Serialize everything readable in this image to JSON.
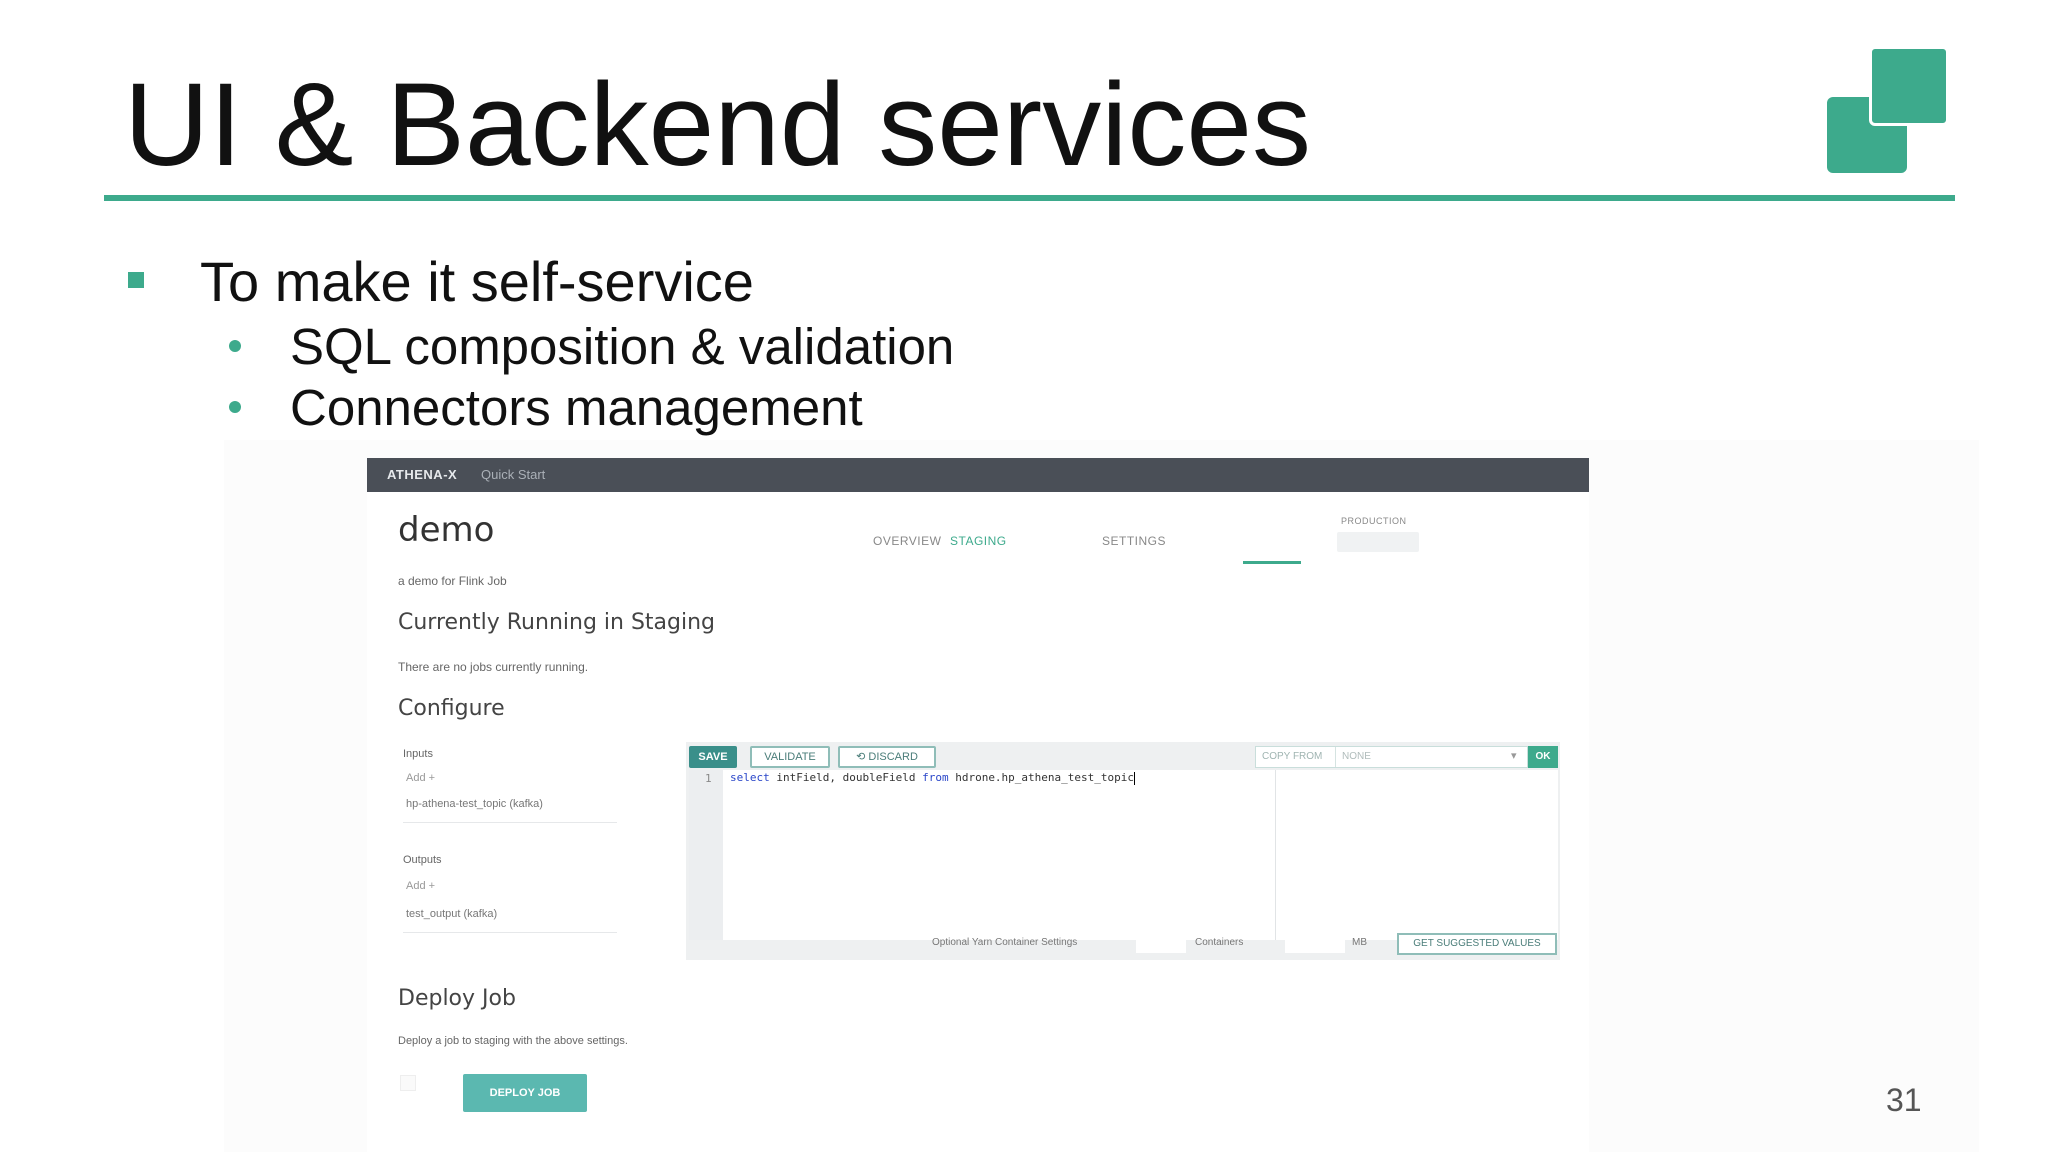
{
  "slide": {
    "title": "UI & Backend services",
    "page_number": "31",
    "bullets": {
      "level1": "To make it self-service",
      "level2": [
        "SQL composition & validation",
        "Connectors management"
      ]
    }
  },
  "app": {
    "brand": "ATHENA-X",
    "nav_link": "Quick Start",
    "job": {
      "title": "demo",
      "description": "a demo for Flink Job"
    },
    "tabs": {
      "overview": "OVERVIEW",
      "staging": "STAGING",
      "production_label": "PRODUCTION",
      "settings": "SETTINGS"
    },
    "running": {
      "heading": "Currently Running in Staging",
      "message": "There are no jobs currently running."
    },
    "configure": {
      "heading": "Configure",
      "inputs_label": "Inputs",
      "inputs_add": "Add +",
      "input_item": "hp-athena-test_topic (kafka)",
      "outputs_label": "Outputs",
      "outputs_add": "Add +",
      "output_item": "test_output (kafka)"
    },
    "editor": {
      "save": "SAVE",
      "validate": "VALIDATE",
      "discard": "⟲ DISCARD",
      "copy_from": "COPY FROM",
      "copy_value": "NONE",
      "ok": "OK",
      "line_number": "1",
      "code_keyword": "select",
      "code_fields": " intField, doubleField ",
      "code_from": "from",
      "code_table": " hdrone.hp_athena_test_topic",
      "yarn_settings": "Optional Yarn Container Settings",
      "containers": "Containers",
      "mb": "MB",
      "suggest": "GET SUGGESTED VALUES"
    },
    "deploy": {
      "heading": "Deploy Job",
      "message": "Deploy a job to staging with the above settings.",
      "button": "DEPLOY JOB"
    }
  },
  "colors": {
    "accent": "#3daa8c",
    "app_bar": "#4a4f57"
  }
}
